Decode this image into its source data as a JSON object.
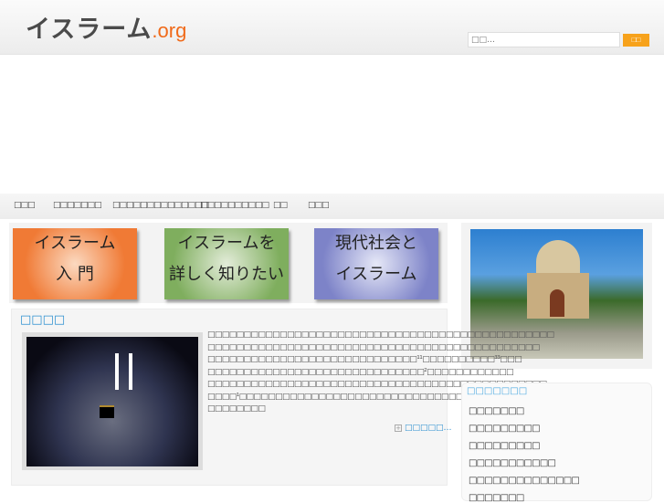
{
  "header": {
    "logo_main": "イスラーム",
    "logo_suffix": ".org",
    "search_placeholder": "□□…",
    "search_button": "□□"
  },
  "nav": [
    "□□□",
    "□□□□□□□",
    "□□□□□□□□□□□□□□",
    "□□□□□□□□□□",
    "□□",
    "□□□"
  ],
  "banners": [
    {
      "line1": "イスラーム",
      "line2": "入 門"
    },
    {
      "line1": "イスラームを",
      "line2": "詳しく知りたい"
    },
    {
      "line1": "現代社会と",
      "line2": "イスラーム"
    }
  ],
  "article": {
    "title": "□□□□",
    "lines": [
      "□□□□□□□□□□□□□□□□□□□□□□□□□□□□□□□□□□□□□□□□□□□□□□□□",
      "□□□□□□□□□□□□□□□□□□□□□□□□□□□□□□□□□□□□□□□□□□□□□□",
      "□□□□□□□□□□□□□□□□□□□□□□□□□□□□□¹¹□□□□□□□□□□³³□□□",
      "□□□□□□□□□□□□□□□□□□□□□□□□□□□□□□²□□□□□□□□□□□□",
      "□□□□□□□□□□□□□□□□□□□□□□□□□□□□□□□□□□□□□□□□□□□□□□□",
      "□□□□¹□□□□□□□□□□□□□□□□□□□□□□□□□□□□□□□□□□□□□□□□□□",
      "□□□□□□□□"
    ],
    "read_more": "□□□□□…"
  },
  "sidebar": {
    "title": "□□□□□□□",
    "items": [
      "□□□□□□□",
      "□□□□□□□□□",
      "□□□□□□□□□",
      "□□□□□□□□□□□",
      "□□□□□□□□□□□□□□",
      "□□□□□□□"
    ]
  }
}
